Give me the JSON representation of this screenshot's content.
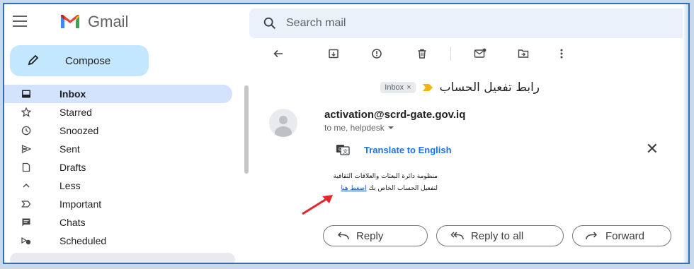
{
  "app": {
    "name": "Gmail"
  },
  "search": {
    "placeholder": "Search mail"
  },
  "compose": {
    "label": "Compose"
  },
  "sidebar": {
    "items": [
      {
        "label": "Inbox",
        "icon": "inbox-icon",
        "active": true
      },
      {
        "label": "Starred",
        "icon": "star-icon"
      },
      {
        "label": "Snoozed",
        "icon": "clock-icon"
      },
      {
        "label": "Sent",
        "icon": "send-icon"
      },
      {
        "label": "Drafts",
        "icon": "draft-icon"
      },
      {
        "label": "Less",
        "icon": "chevron-up-icon"
      },
      {
        "label": "Important",
        "icon": "important-icon"
      },
      {
        "label": "Chats",
        "icon": "chat-icon"
      },
      {
        "label": "Scheduled",
        "icon": "scheduled-icon"
      }
    ]
  },
  "message": {
    "subject": "رابط تفعيل الحساب",
    "label_chip": "Inbox",
    "label_chip_close": "×",
    "sender": "activation@scrd-gate.gov.iq",
    "recipients": "to me, helpdesk",
    "translate_label": "Translate to English",
    "translate_close": "✕",
    "body_line1": "منظومة دائرة البعثات والعلاقات الثقافية",
    "body_line2_text": "لتفعيل الحساب الخاص بك ",
    "body_link": "اضغط هنا"
  },
  "actions": {
    "reply": "Reply",
    "reply_all": "Reply to all",
    "forward": "Forward"
  },
  "colors": {
    "accent": "#1a73e8",
    "compose_bg": "#c2e7ff",
    "active_nav": "#d3e3fd",
    "search_bg": "#eaf1fb",
    "arrow": "#e5252a",
    "frame_border": "#2f6fb8"
  }
}
